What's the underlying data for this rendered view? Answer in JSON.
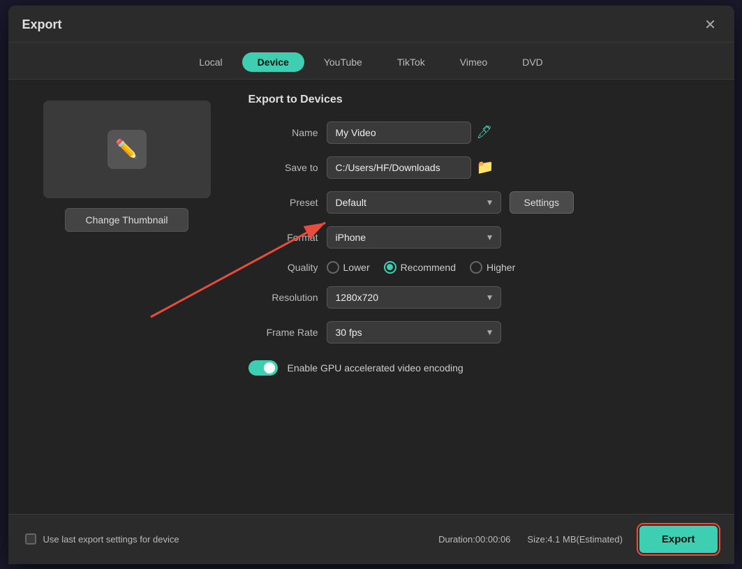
{
  "dialog": {
    "title": "Export",
    "close_label": "✕"
  },
  "tabs": {
    "items": [
      {
        "label": "Local",
        "active": false
      },
      {
        "label": "Device",
        "active": true
      },
      {
        "label": "YouTube",
        "active": false
      },
      {
        "label": "TikTok",
        "active": false
      },
      {
        "label": "Vimeo",
        "active": false
      },
      {
        "label": "DVD",
        "active": false
      }
    ]
  },
  "thumbnail": {
    "change_label": "Change Thumbnail"
  },
  "export_section": {
    "title": "Export to Devices",
    "name_label": "Name",
    "name_value": "My Video",
    "save_to_label": "Save to",
    "save_to_value": "C:/Users/HF/Downloads",
    "preset_label": "Preset",
    "preset_value": "Default",
    "settings_label": "Settings",
    "format_label": "Format",
    "format_value": "iPhone",
    "quality_label": "Quality",
    "quality_options": [
      {
        "label": "Lower",
        "selected": false
      },
      {
        "label": "Recommend",
        "selected": true
      },
      {
        "label": "Higher",
        "selected": false
      }
    ],
    "resolution_label": "Resolution",
    "resolution_value": "1280x720",
    "frame_rate_label": "Frame Rate",
    "frame_rate_value": "30 fps",
    "gpu_label": "Enable GPU accelerated video encoding"
  },
  "footer": {
    "checkbox_label": "Use last export settings for device",
    "duration_label": "Duration:",
    "duration_value": "00:00:06",
    "size_label": "Size:",
    "size_value": "4.1 MB(Estimated)",
    "export_label": "Export"
  }
}
